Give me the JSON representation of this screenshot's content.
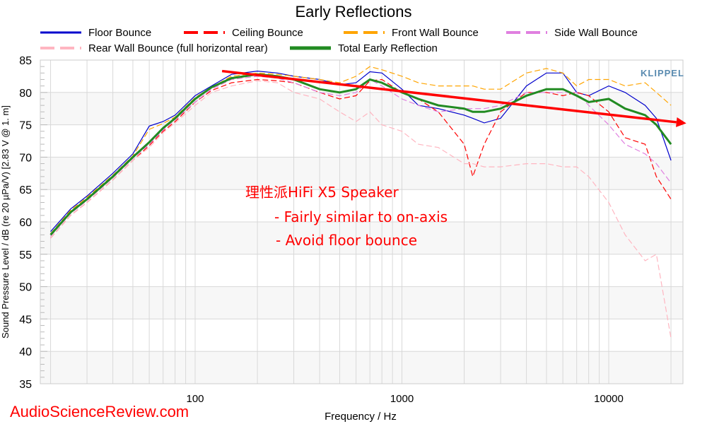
{
  "chart_data": {
    "type": "line",
    "title": "Early Reflections",
    "xlabel": "Frequency / Hz",
    "ylabel": "Sound Pressure Level / dB (re 20 µPa/V)  [2.83  V @ 1. m]",
    "xscale": "log",
    "xlim": [
      17.8,
      23000
    ],
    "ylim": [
      35,
      85
    ],
    "xticks": [
      100,
      1000,
      10000
    ],
    "xtick_labels": [
      "100",
      "1000",
      "10000"
    ],
    "yticks": [
      35,
      40,
      45,
      50,
      55,
      60,
      65,
      70,
      75,
      80,
      85
    ],
    "grid": true,
    "legend": "top",
    "x": [
      20,
      25,
      30,
      40,
      50,
      60,
      70,
      80,
      100,
      120,
      150,
      200,
      250,
      300,
      400,
      500,
      600,
      700,
      800,
      1000,
      1200,
      1500,
      2000,
      2200,
      2500,
      3000,
      4000,
      5000,
      6000,
      7000,
      8000,
      10000,
      12000,
      15000,
      17000,
      20000
    ],
    "series": [
      {
        "name": "Floor Bounce",
        "color": "#0000cc",
        "style": "solid",
        "values": [
          58.5,
          62,
          64,
          67.5,
          70.5,
          74.8,
          75.5,
          76.5,
          79.5,
          81,
          82.8,
          83.3,
          83,
          82.5,
          82,
          81.2,
          81.5,
          83.2,
          83,
          80.5,
          78,
          77.5,
          76.5,
          76,
          75.3,
          76,
          81,
          83,
          83,
          80,
          79.5,
          81,
          80,
          78,
          76,
          69.5
        ]
      },
      {
        "name": "Ceiling Bounce",
        "color": "#ff0000",
        "style": "dash",
        "values": [
          57.5,
          61,
          63,
          66.5,
          69.5,
          71.8,
          74,
          75.5,
          78.5,
          80.3,
          81.5,
          82,
          81.8,
          81.5,
          80,
          79,
          79.5,
          81.8,
          82,
          80,
          79,
          77,
          72,
          67,
          72,
          77,
          80,
          80,
          79.5,
          80,
          79.5,
          77,
          73,
          72,
          67,
          63.5
        ]
      },
      {
        "name": "Front Wall Bounce",
        "color": "#ffa500",
        "style": "dash",
        "values": [
          58.2,
          61.8,
          63.8,
          67.2,
          70.2,
          74.3,
          75.2,
          76.2,
          79.2,
          80.8,
          82.5,
          83,
          82.8,
          82.5,
          82,
          81.5,
          82.5,
          84,
          83.5,
          82.5,
          81.5,
          81,
          81,
          81,
          80.5,
          80.5,
          83,
          83.7,
          83,
          81,
          82,
          82,
          81,
          81.5,
          80,
          78
        ]
      },
      {
        "name": "Side Wall Bounce",
        "color": "#e080e0",
        "style": "dash",
        "values": [
          57.8,
          61.3,
          63.3,
          66.8,
          69.8,
          72,
          74.2,
          75.8,
          78.5,
          80.5,
          82,
          82.5,
          82.2,
          81.5,
          80,
          79.5,
          80,
          82,
          81,
          79,
          78,
          77,
          77.5,
          77.5,
          77.5,
          78,
          80,
          80,
          80,
          80,
          78,
          75,
          72,
          70.5,
          69,
          66
        ]
      },
      {
        "name": "Rear Wall Bounce (full horizontal rear)",
        "color": "#ffb6c1",
        "style": "dash",
        "values": [
          57.5,
          61,
          63,
          66.5,
          69.5,
          71.5,
          73.8,
          75.3,
          78,
          80,
          81,
          81.8,
          81.5,
          80,
          79,
          77,
          75.5,
          77,
          75,
          74,
          72,
          71.5,
          69,
          69,
          68.5,
          68.5,
          69,
          69,
          68.5,
          68.5,
          67,
          63,
          58,
          54,
          55,
          42
        ]
      },
      {
        "name": "Total Early Reflection",
        "color": "#228b22",
        "style": "solid-thick",
        "values": [
          58,
          61.5,
          63.5,
          67,
          70,
          72.3,
          74.5,
          76,
          79,
          80.8,
          82.2,
          82.8,
          82.5,
          82,
          80.5,
          80,
          80.5,
          82,
          81.5,
          80,
          79,
          78,
          77.5,
          77,
          77,
          77.5,
          79.5,
          80.5,
          80.5,
          79.5,
          78.5,
          79,
          77.5,
          76.5,
          75,
          72
        ]
      }
    ],
    "annotations": {
      "title": "理性派HiFi X5 Speaker",
      "line1": "- Fairly similar to on-axis",
      "line2": "- Avoid floor bounce",
      "trend_arrow": {
        "from": [
          135,
          83.3
        ],
        "to": [
          23000,
          75.4
        ],
        "color": "#ff0000"
      }
    }
  },
  "logo": "KLIPPEL",
  "watermark": "AudioScienceReview.com"
}
